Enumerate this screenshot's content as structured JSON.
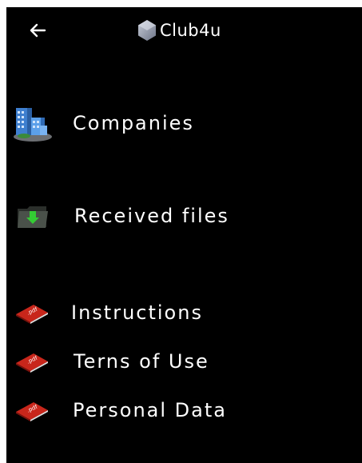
{
  "header": {
    "back_icon": "arrow-left-icon",
    "app_logo_icon": "hexagon-logo-icon",
    "app_name": "Club4u"
  },
  "menu": {
    "items": [
      {
        "label": "Companies",
        "icon": "building-icon"
      },
      {
        "label": "Received files",
        "icon": "folder-download-icon"
      },
      {
        "label": "Instructions",
        "icon": "pdf-icon"
      },
      {
        "label": "Terns of Use",
        "icon": "pdf-icon"
      },
      {
        "label": "Personal Data",
        "icon": "pdf-icon"
      }
    ]
  },
  "colors": {
    "background": "#000000",
    "text": "#ffffff",
    "pdf_red": "#c8261b",
    "folder_dark": "#3a3f3a",
    "download_green": "#2dc22d",
    "building_blue": "#4a8fd8"
  }
}
